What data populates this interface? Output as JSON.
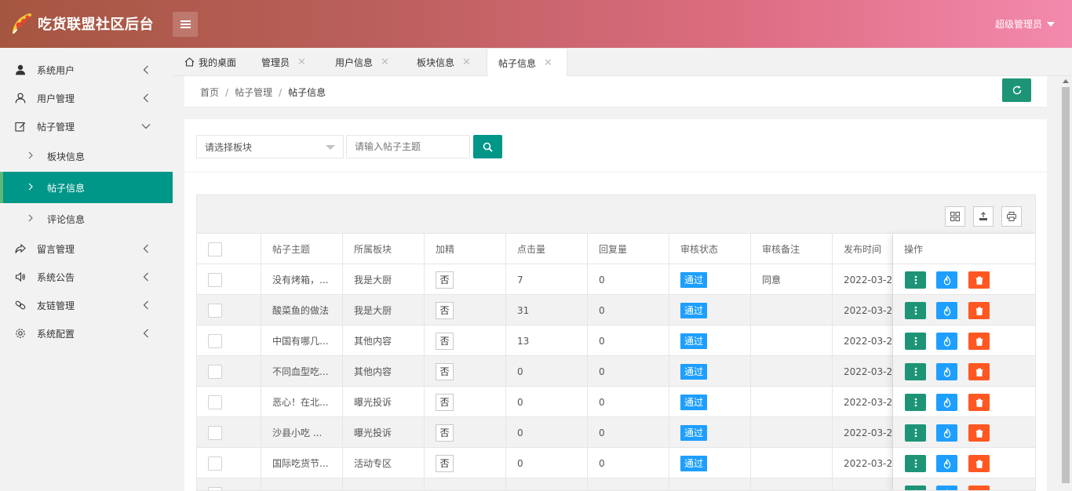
{
  "header": {
    "title": "吃货联盟社区后台",
    "admin_label": "超级管理员"
  },
  "sidebar": {
    "items": [
      {
        "label": "系统用户",
        "icon": "person-icon"
      },
      {
        "label": "用户管理",
        "icon": "user-outline-icon"
      },
      {
        "label": "帖子管理",
        "icon": "edit-icon"
      },
      {
        "label": "留言管理",
        "icon": "share-icon"
      },
      {
        "label": "系统公告",
        "icon": "speaker-icon"
      },
      {
        "label": "友链管理",
        "icon": "link-icon"
      },
      {
        "label": "系统配置",
        "icon": "gear-icon"
      }
    ],
    "sub_items": [
      {
        "label": "板块信息"
      },
      {
        "label": "帖子信息"
      },
      {
        "label": "评论信息"
      }
    ]
  },
  "tabs": [
    {
      "label": "我的桌面"
    },
    {
      "label": "管理员"
    },
    {
      "label": "用户信息"
    },
    {
      "label": "板块信息"
    },
    {
      "label": "帖子信息"
    }
  ],
  "breadcrumb": {
    "home": "首页",
    "level1": "帖子管理",
    "current": "帖子信息",
    "separator": "/"
  },
  "search": {
    "select_placeholder": "请选择板块",
    "input_placeholder": "请输入帖子主题"
  },
  "table": {
    "headers": [
      "帖子主题",
      "所属板块",
      "加精",
      "点击量",
      "回复量",
      "审核状态",
      "审核备注",
      "发布时间",
      "操作"
    ],
    "rows": [
      {
        "topic": "没有烤箱，...",
        "section": "我是大厨",
        "featured": "否",
        "clicks": "7",
        "replies": "0",
        "status": "通过",
        "note": "同意",
        "time": "2022-03-2..."
      },
      {
        "topic": "酸菜鱼的做法",
        "section": "我是大厨",
        "featured": "否",
        "clicks": "31",
        "replies": "0",
        "status": "通过",
        "note": "",
        "time": "2022-03-2..."
      },
      {
        "topic": "中国有哪几...",
        "section": "其他内容",
        "featured": "否",
        "clicks": "13",
        "replies": "0",
        "status": "通过",
        "note": "",
        "time": "2022-03-2..."
      },
      {
        "topic": "不同血型吃...",
        "section": "其他内容",
        "featured": "否",
        "clicks": "0",
        "replies": "0",
        "status": "通过",
        "note": "",
        "time": "2022-03-2..."
      },
      {
        "topic": "恶心！在北...",
        "section": "曝光投诉",
        "featured": "否",
        "clicks": "0",
        "replies": "0",
        "status": "通过",
        "note": "",
        "time": "2022-03-2..."
      },
      {
        "topic": "沙县小吃 ...",
        "section": "曝光投诉",
        "featured": "否",
        "clicks": "0",
        "replies": "0",
        "status": "通过",
        "note": "",
        "time": "2022-03-2..."
      },
      {
        "topic": "国际吃货节...",
        "section": "活动专区",
        "featured": "否",
        "clicks": "0",
        "replies": "0",
        "status": "通过",
        "note": "",
        "time": "2022-03-2..."
      },
      {
        "topic": "",
        "section": "",
        "featured": "",
        "clicks": "",
        "replies": "",
        "status": "",
        "note": "",
        "time": ""
      }
    ]
  },
  "colors": {
    "primary": "#009688",
    "blue": "#1e9fff",
    "danger": "#ff5722",
    "header_start": "#a55640",
    "header_end": "#f389ad"
  }
}
